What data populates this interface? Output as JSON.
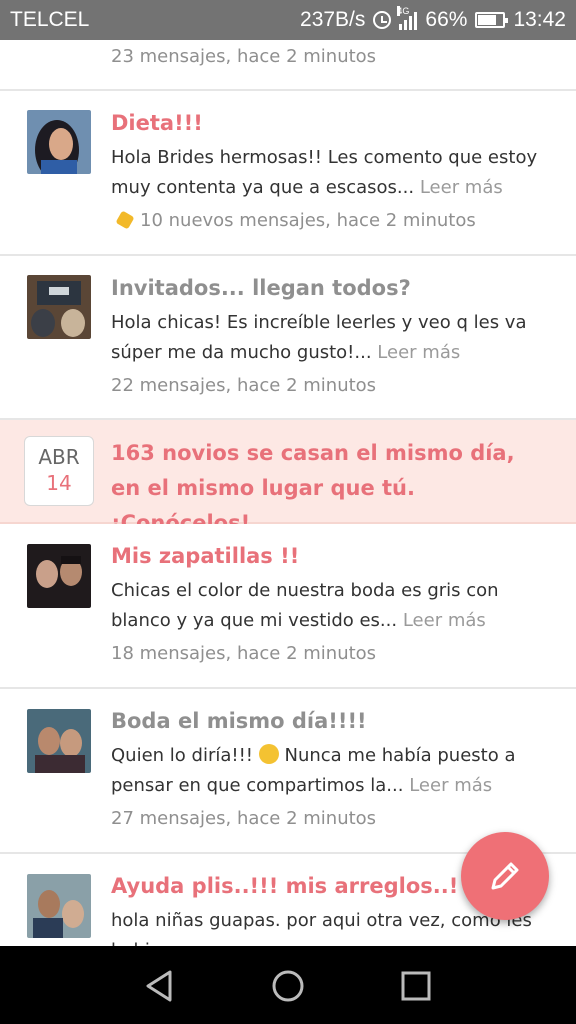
{
  "status_bar": {
    "carrier": "TELCEL",
    "speed": "237B/s",
    "network": "4G",
    "battery": "66%",
    "time": "13:42"
  },
  "feed": {
    "top_meta": "23 mensajes, hace 2 minutos",
    "posts": [
      {
        "title": "Dieta!!!",
        "excerpt": "Hola Brides hermosas!! Les comento que estoy muy contenta ya que a escasos...",
        "more": "Leer más",
        "meta": "10 nuevos mensajes, hace 2 minutos",
        "unread": true
      },
      {
        "title": "Invitados... llegan todos?",
        "excerpt": "Hola chicas! Es increíble leerles y veo q les va súper me da mucho gusto!...",
        "more": "Leer más",
        "meta": "22 mensajes, hace 2 minutos",
        "unread": false
      },
      {
        "title": "Mis zapatillas      !!",
        "excerpt": "Chicas el color de nuestra boda es gris con blanco y ya que mi vestido es...",
        "more": "Leer más",
        "meta": "18 mensajes, hace 2 minutos",
        "unread": true
      },
      {
        "title": "Boda el mismo día!!!!",
        "excerpt_a": "Quien lo diría!!!",
        "excerpt_b": "Nunca me había puesto a pensar en que compartimos la...",
        "more": "Leer más",
        "meta": "27 mensajes, hace 2 minutos",
        "unread": false
      },
      {
        "title": "Ayuda plis..!!! mis arreglos..!",
        "excerpt": "hola niñas guapas. por aqui otra vez, como les habia",
        "unread": true
      }
    ],
    "promo": {
      "month": "ABR",
      "day": "14",
      "text": "163 novios se casan el mismo día, en el mismo lugar que tú. ¡Conócelos!"
    }
  },
  "colors": {
    "accent": "#e8717a",
    "status_bar": "#737373",
    "promo_bg": "#fde8e4",
    "fab": "#ef7076"
  },
  "icons": {
    "fab": "pencil-icon",
    "nav": [
      "back-icon",
      "home-icon",
      "recents-icon"
    ]
  }
}
